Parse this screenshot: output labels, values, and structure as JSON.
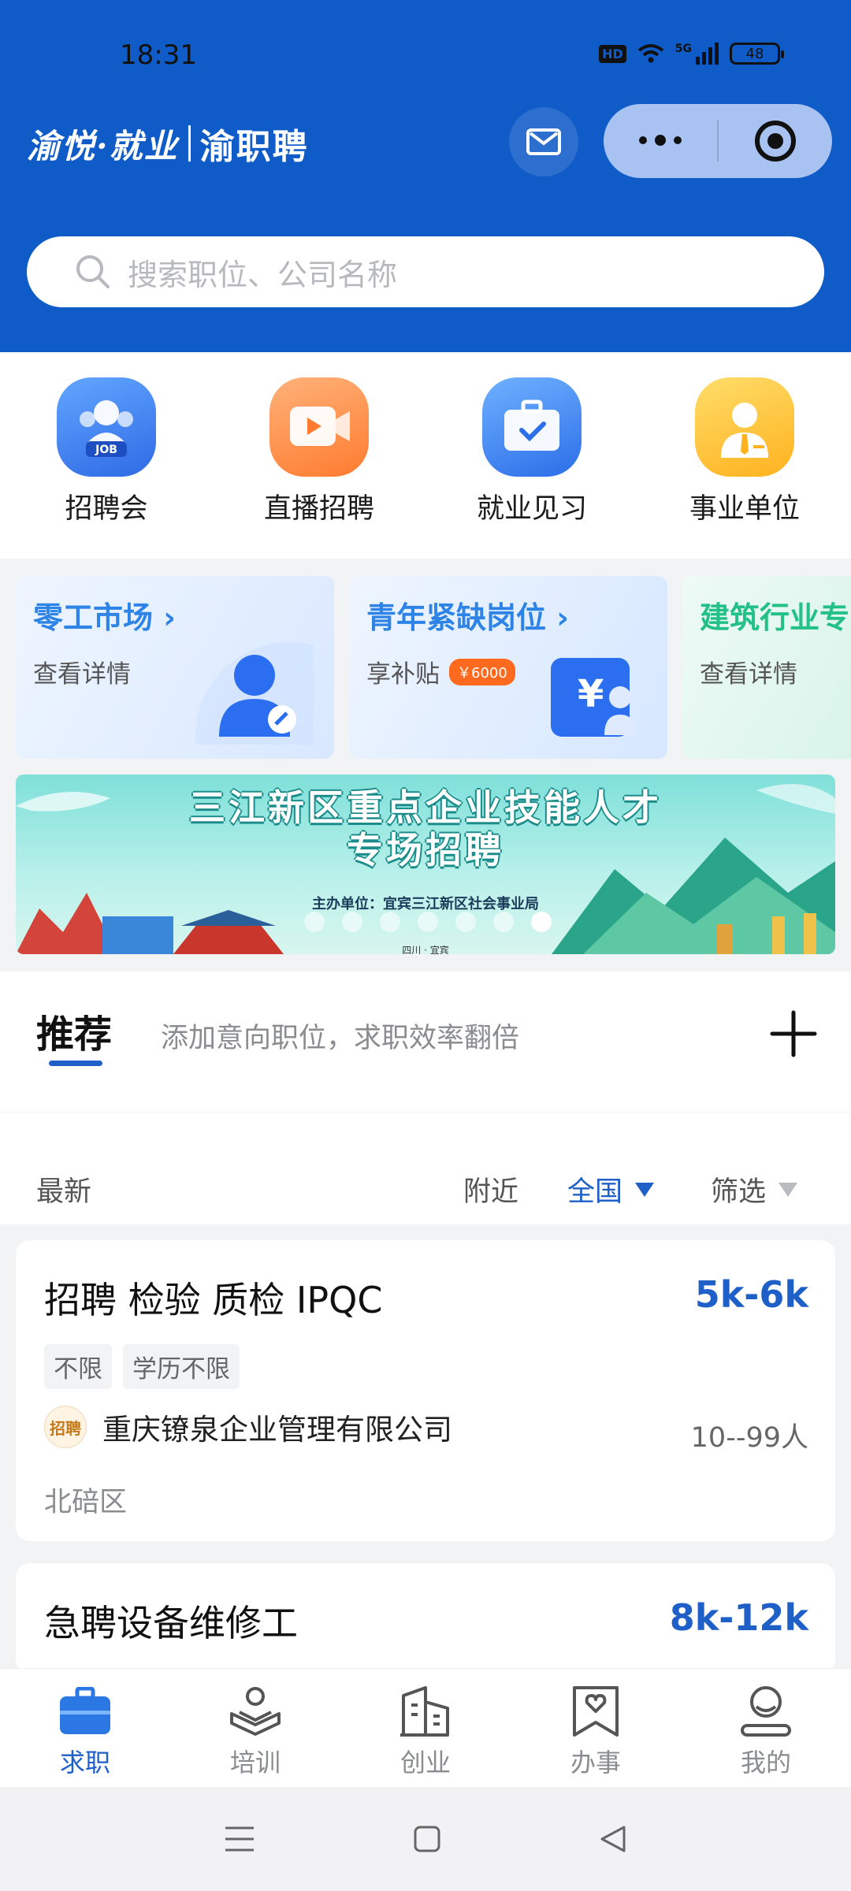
{
  "status": {
    "time": "18:31",
    "hd": "HD",
    "network": "5G",
    "battery": "48"
  },
  "header": {
    "brand_script": "渝悦·就业",
    "brand_main": "渝职聘"
  },
  "search": {
    "placeholder": "搜索职位、公司名称"
  },
  "quick": [
    {
      "label": "招聘会",
      "icon": "job-fair-icon",
      "badge": "JOB"
    },
    {
      "label": "直播招聘",
      "icon": "live-video-icon"
    },
    {
      "label": "就业见习",
      "icon": "briefcase-icon"
    },
    {
      "label": "事业单位",
      "icon": "staff-icon"
    }
  ],
  "promo": [
    {
      "title": "零工市场",
      "sub": "查看详情"
    },
    {
      "title": "青年紧缺岗位",
      "sub": "享补贴",
      "badge": "￥6000"
    },
    {
      "title": "建筑行业专",
      "sub": "查看详情"
    }
  ],
  "banner": {
    "line1": "三江新区重点企业技能人才",
    "line2": "专场招聘",
    "sponsor": "主办单位：宜宾三江新区社会事业局",
    "place": "四川 · 宜宾"
  },
  "tabs": {
    "recommend": "推荐",
    "hint": "添加意向职位，求职效率翻倍"
  },
  "filter": {
    "latest": "最新",
    "nearby": "附近",
    "nationwide": "全国",
    "screen": "筛选"
  },
  "jobs": [
    {
      "title": "招聘 检验 质检 IPQC",
      "salary": "5k-6k",
      "tags": [
        "不限",
        "学历不限"
      ],
      "company_logo": "招聘",
      "company": "重庆镣泉企业管理有限公司",
      "size": "10--99人",
      "area": "北碚区"
    },
    {
      "title": "急聘设备维修工",
      "salary": "8k-12k"
    }
  ],
  "bottom_nav": [
    {
      "label": "求职",
      "icon": "briefcase-icon",
      "active": true
    },
    {
      "label": "培训",
      "icon": "training-icon"
    },
    {
      "label": "创业",
      "icon": "building-icon"
    },
    {
      "label": "办事",
      "icon": "heart-bookmark-icon"
    },
    {
      "label": "我的",
      "icon": "profile-icon"
    }
  ],
  "colors": {
    "primary": "#0f5cc8",
    "accent": "#1f60c8",
    "orange": "#ff7b2f"
  }
}
